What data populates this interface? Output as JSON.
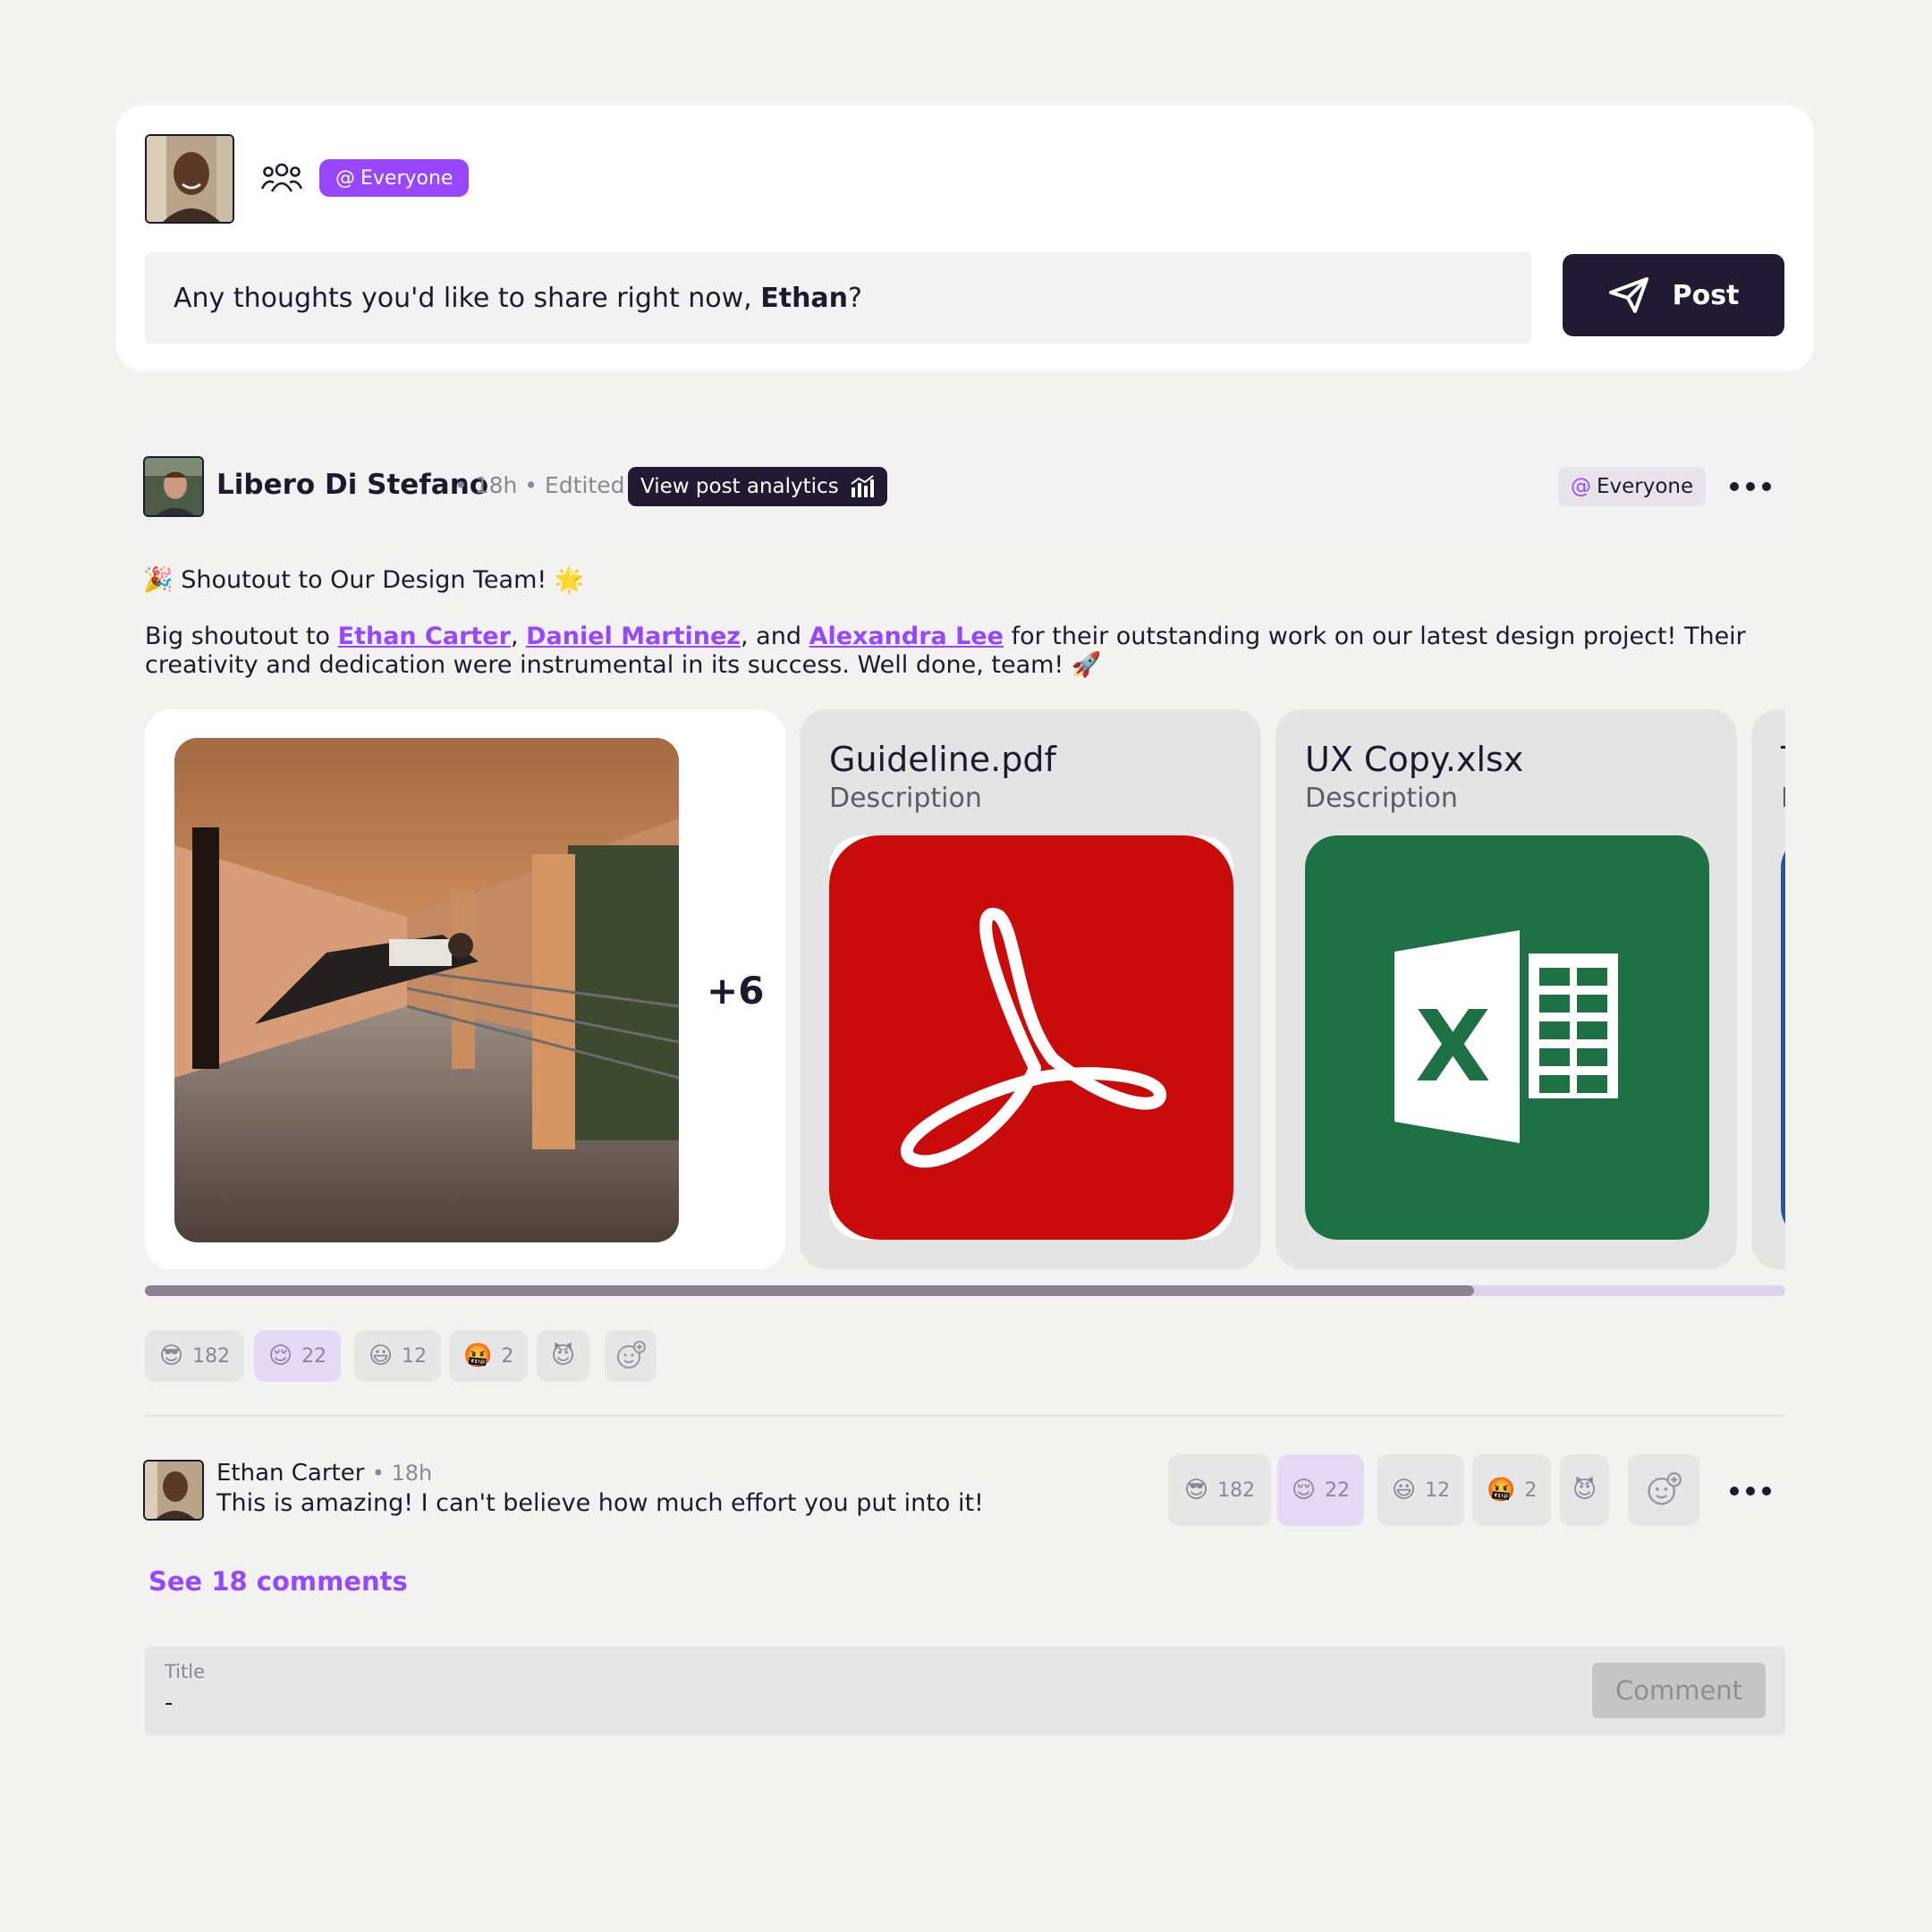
{
  "composer": {
    "user_name": "Ethan",
    "audience_label": "Everyone",
    "prompt_before": "Any thoughts you'd like to share right now, ",
    "prompt_after": "?",
    "post_label": "Post"
  },
  "post": {
    "author": "Libero Di Stefano",
    "meta": "• 18h • Edtited",
    "analytics_label": "View post analytics",
    "audience_label": "Everyone",
    "title": "Shoutout to Our Design Team!",
    "title_emoji_start": "🎉",
    "title_emoji_end": "🌟",
    "body_start": "Big shoutout to ",
    "mentions": [
      "Ethan Carter",
      "Daniel Martinez",
      "Alexandra Lee"
    ],
    "sep1": ", ",
    "sep2": ", and ",
    "body_end": " for their outstanding work on our latest design project! Their creativity and dedication were instrumental in its success. Well done, team! ",
    "body_emoji": "🚀",
    "gallery_more": "+6",
    "files": [
      {
        "name": "Guideline.pdf",
        "description": "Description",
        "icon": "pdf-icon",
        "color": "#cc0a0a"
      },
      {
        "name": "UX Copy.xlsx",
        "description": "Description",
        "icon": "excel-icon",
        "color": "#1e7145"
      },
      {
        "name": "T",
        "description": "D",
        "icon": "word-icon",
        "color": "#2b5797"
      }
    ],
    "scroll_fraction": 0.81,
    "reactions": [
      {
        "emoji": "😎",
        "count": "182",
        "active": false
      },
      {
        "emoji": "😌",
        "count": "22",
        "active": true
      },
      {
        "emoji": "😃",
        "count": "12",
        "active": false
      },
      {
        "emoji": "🤬",
        "count": "2",
        "active": false
      },
      {
        "emoji": "😈",
        "count": "",
        "active": false
      }
    ]
  },
  "comment": {
    "author": "Ethan Carter",
    "meta": "• 18h",
    "text": "This is amazing! I can't believe how much effort you put into it!",
    "reactions": [
      {
        "emoji": "😎",
        "count": "182"
      },
      {
        "emoji": "😌",
        "count": "22"
      },
      {
        "emoji": "😃",
        "count": "12"
      },
      {
        "emoji": "🤬",
        "count": "2"
      },
      {
        "emoji": "😈",
        "count": ""
      }
    ]
  },
  "see_comments_label": "See 18 comments",
  "comment_input": {
    "label": "Title",
    "value": "-",
    "submit_label": "Comment"
  },
  "colors": {
    "accent": "#9747ff",
    "dark": "#211a32",
    "background": "#f2f2f0"
  }
}
